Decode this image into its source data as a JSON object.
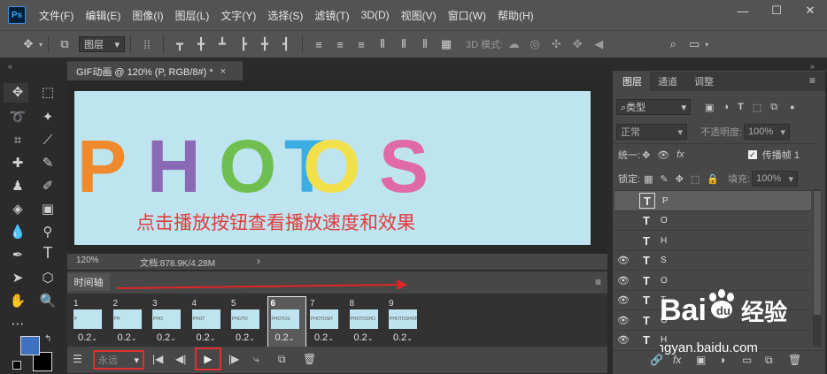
{
  "menu": [
    "文件(F)",
    "编辑(E)",
    "图像(I)",
    "图层(L)",
    "文字(Y)",
    "选择(S)",
    "滤镜(T)",
    "3D(D)",
    "视图(V)",
    "窗口(W)",
    "帮助(H)"
  ],
  "app_logo": "Ps",
  "options": {
    "layer_select": "图层",
    "mode_3d": "3D 模式:"
  },
  "document": {
    "tab_title": "GIF动画 @ 120% (P, RGB/8#) *",
    "letters": [
      {
        "char": "P",
        "color": "#ef8a2c"
      },
      {
        "char": "H",
        "color": "#8a6ab4"
      },
      {
        "char": "O",
        "color": "#6fbf50"
      },
      {
        "char": "T",
        "color": "#3aaee3"
      },
      {
        "char": "O",
        "color": "#f2e04a"
      },
      {
        "char": "S",
        "color": "#e06aa8"
      }
    ],
    "caption": "点击播放按钮查看播放速度和效果",
    "caption_color": "#e23b3b",
    "canvas_bg": "#bee4ef"
  },
  "status": {
    "zoom": "120%",
    "doc_info": "文档:878.9K/4.28M",
    "arrow": "›"
  },
  "timeline": {
    "tab": "时间轴",
    "frames": [
      {
        "num": "1",
        "thumb": "P",
        "delay": "0.2"
      },
      {
        "num": "2",
        "thumb": "PH",
        "delay": "0.2"
      },
      {
        "num": "3",
        "thumb": "PHO",
        "delay": "0.2"
      },
      {
        "num": "4",
        "thumb": "PHOT",
        "delay": "0.2"
      },
      {
        "num": "5",
        "thumb": "PHOTO",
        "delay": "0.2"
      },
      {
        "num": "6",
        "thumb": "PHOTOS",
        "delay": "0.2"
      },
      {
        "num": "7",
        "thumb": "PHOTOSH",
        "delay": "0.2"
      },
      {
        "num": "8",
        "thumb": "PHOTOSHO",
        "delay": "0.2"
      },
      {
        "num": "9",
        "thumb": "PHOTOSHOP",
        "delay": "0.2"
      }
    ],
    "selected_frame": 6,
    "loop": "永远",
    "highlight_color": "#e23030"
  },
  "layers_panel": {
    "tabs": [
      "图层",
      "通道",
      "调整"
    ],
    "kind_filter": "类型",
    "blend_mode": "正常",
    "opacity_label": "不透明度:",
    "opacity": "100%",
    "unify_label": "统一:",
    "propagate_label": "传播帧 1",
    "lock_label": "锁定:",
    "fill_label": "填充:",
    "fill": "100%",
    "layers": [
      {
        "name": "P",
        "visible": false,
        "selected": true
      },
      {
        "name": "O",
        "visible": false,
        "selected": false
      },
      {
        "name": "H",
        "visible": false,
        "selected": false
      },
      {
        "name": "S",
        "visible": true,
        "selected": false
      },
      {
        "name": "O",
        "visible": true,
        "selected": false
      },
      {
        "name": "T",
        "visible": true,
        "selected": false
      },
      {
        "name": "O",
        "visible": true,
        "selected": false
      },
      {
        "name": "H",
        "visible": true,
        "selected": false
      }
    ]
  },
  "watermark": {
    "brand": "Bai",
    "brand2": "经验",
    "url": "jingyan.baidu.com"
  }
}
